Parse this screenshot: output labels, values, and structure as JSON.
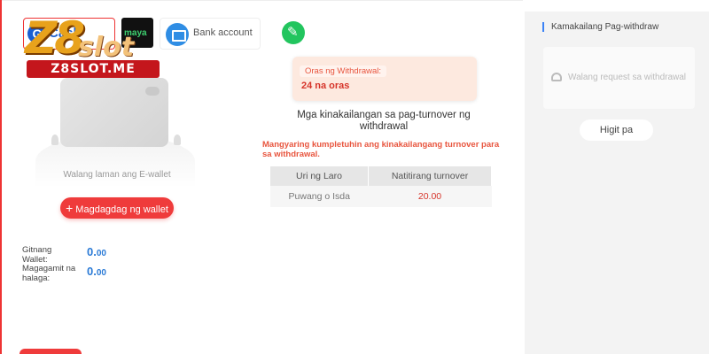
{
  "logo": {
    "main": "Z8",
    "sub": "slot",
    "band": "Z8SLOT.ME"
  },
  "tabs": {
    "gcash_letter": "G",
    "gcash_label": "Cash",
    "maya_label": "maya",
    "bank_label": "Bank account"
  },
  "wallet": {
    "empty_text": "Walang laman ang E-wallet",
    "add_label": "Magdagdag ng wallet",
    "center_label": "Gitnang Wallet:",
    "center_value": "0.",
    "center_value_dec": "00",
    "usable_label": "Magagamit na halaga:",
    "usable_value": "0.",
    "usable_value_dec": "00"
  },
  "withdrawal": {
    "time_label": "Oras ng Withdrawal:",
    "time_value": "24 na oras",
    "requirements_title": "Mga kinakailangan sa pag-turnover ng withdrawal",
    "warning": "Mangyaring kumpletuhin ang kinakailangang turnover para sa withdrawal.",
    "table": {
      "headers": [
        "Uri ng Laro",
        "Natitirang turnover"
      ],
      "rows": [
        [
          "Puwang o Isda",
          "20.00"
        ]
      ]
    }
  },
  "recent": {
    "title": "Kamakailang Pag-withdraw",
    "empty_text": "Walang request sa withdrawal",
    "more_label": "Higit pa"
  },
  "colors": {
    "accent": "#ef3b3b",
    "link_blue": "#2a7ad6",
    "success": "#22c55e"
  }
}
